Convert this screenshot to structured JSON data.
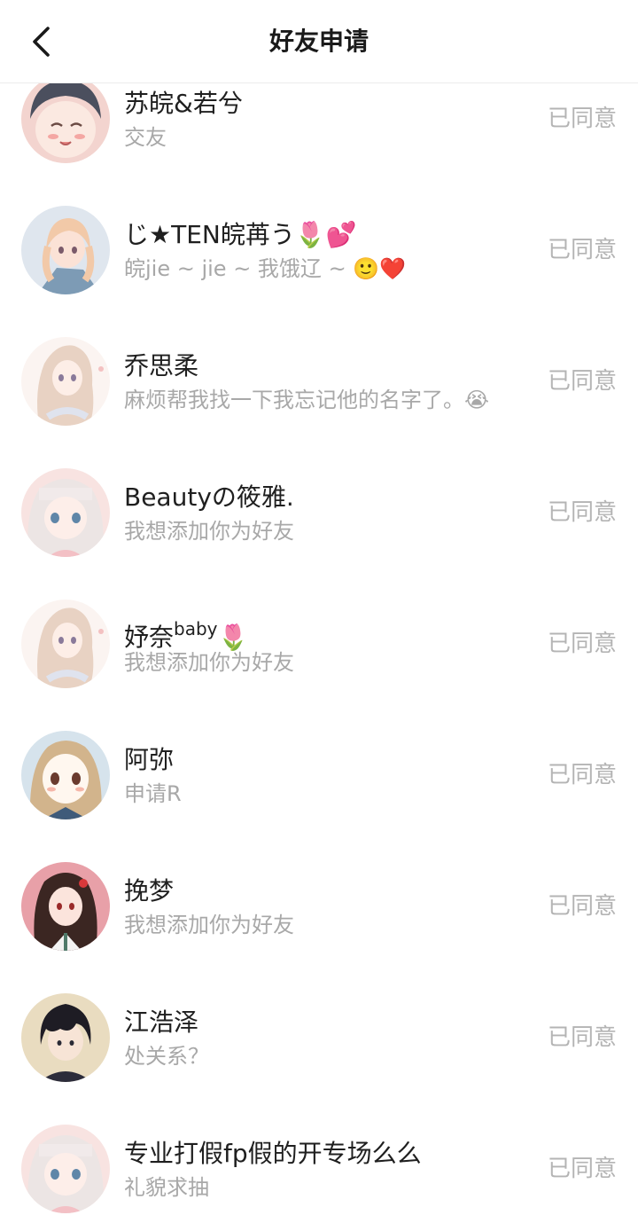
{
  "header": {
    "title": "好友申请",
    "back_icon": "chevron-left-icon"
  },
  "requests": [
    {
      "name": "苏皖&若兮",
      "message": "交友",
      "status": "已同意",
      "avatar_bg": "#f3d4cf",
      "avatar_hair": "#4b4f5e"
    },
    {
      "name": "じ★TEN皖苒う🌷💕",
      "message": "皖jie ~ jie ~ 我饿辽 ~ 🙂❤️",
      "status": "已同意",
      "avatar_bg": "#dfe6ee",
      "avatar_hair": "#f2c9a8"
    },
    {
      "name": "乔思柔",
      "message": "麻烦帮我找一下我忘记他的名字了。😭",
      "status": "已同意",
      "avatar_bg": "#fbf4f1",
      "avatar_hair": "#e8d2c3"
    },
    {
      "name": "Beautyの筱雅.",
      "message": "我想添加你为好友",
      "status": "已同意",
      "avatar_bg": "#f8e3e1",
      "avatar_hair": "#ece5e4"
    },
    {
      "name": "妤奈",
      "name_sup": "baby",
      "name_tail": "🌷",
      "message": "我想添加你为好友",
      "status": "已同意",
      "avatar_bg": "#fbf4f1",
      "avatar_hair": "#e8d2c3"
    },
    {
      "name": "阿弥",
      "message": "申请R",
      "status": "已同意",
      "avatar_bg": "#d6e3ec",
      "avatar_hair": "#d2b48c"
    },
    {
      "name": "挽梦",
      "message": "我想添加你为好友",
      "status": "已同意",
      "avatar_bg": "#e8a0a8",
      "avatar_hair": "#3b2622"
    },
    {
      "name": "江浩泽",
      "message": "处关系？",
      "status": "已同意",
      "avatar_bg": "#e9dcc0",
      "avatar_hair": "#1e1c24"
    },
    {
      "name": "专业打假fp假的开专场么么",
      "message": "礼貌求抽",
      "status": "已同意",
      "avatar_bg": "#f8e3e1",
      "avatar_hair": "#ece5e4"
    }
  ]
}
